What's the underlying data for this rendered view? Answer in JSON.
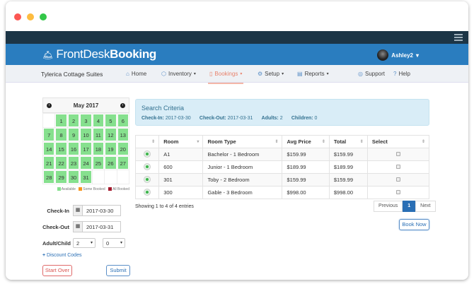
{
  "window": {
    "controls": [
      "close",
      "minimize",
      "maximize"
    ]
  },
  "brand": {
    "logo_light": "FrontDesk",
    "logo_bold": "Booking",
    "user": "Ashley2"
  },
  "nav": {
    "property": "Tylerica Cottage Suites",
    "items": [
      {
        "label": "Home",
        "icon": "home-icon",
        "caret": ""
      },
      {
        "label": "Inventory",
        "icon": "cube-icon",
        "caret": "▾"
      },
      {
        "label": "Bookings",
        "icon": "bookings-icon",
        "caret": "▾"
      },
      {
        "label": "Setup",
        "icon": "gears-icon",
        "caret": "▾"
      },
      {
        "label": "Reports",
        "icon": "reports-icon",
        "caret": "▾"
      },
      {
        "label": "Support",
        "icon": "lifebuoy-icon",
        "caret": ""
      },
      {
        "label": "Help",
        "icon": "help-icon",
        "caret": ""
      }
    ]
  },
  "calendar": {
    "title": "May 2017",
    "prev": "‹",
    "next": "›",
    "days": [
      "",
      "1",
      "2",
      "3",
      "4",
      "5",
      "6",
      "7",
      "8",
      "9",
      "10",
      "11",
      "12",
      "13",
      "14",
      "15",
      "16",
      "17",
      "18",
      "19",
      "20",
      "21",
      "22",
      "23",
      "24",
      "25",
      "26",
      "27",
      "28",
      "29",
      "30",
      "31",
      "",
      "",
      ""
    ],
    "legend": {
      "available": "Available",
      "some": "Some Booked",
      "all": "All Booked"
    },
    "colors": {
      "available": "#86e08e",
      "some": "#f7941d",
      "all": "#a3182b"
    }
  },
  "form": {
    "checkin_label": "Check-In",
    "checkin": "2017-03-30",
    "checkout_label": "Check-Out",
    "checkout": "2017-03-31",
    "adultchild_label": "Adult/Child",
    "adults": "2",
    "children": "0",
    "discount": "Discount Codes",
    "start_over": "Start Over",
    "submit": "Submit"
  },
  "criteria": {
    "title": "Search Criteria",
    "checkin_label": "Check-In:",
    "checkin": "2017-03-30",
    "checkout_label": "Check-Out:",
    "checkout": "2017-03-31",
    "adults_label": "Adults:",
    "adults": "2",
    "children_label": "Children:",
    "children": "0"
  },
  "table": {
    "headers": [
      "",
      "Room",
      "Room Type",
      "Avg Price",
      "Total",
      "Select"
    ],
    "rows": [
      {
        "room": "A1",
        "type": "Bachelor - 1 Bedroom",
        "avg": "$159.99",
        "total": "$159.99"
      },
      {
        "room": "600",
        "type": "Junior - 1 Bedroom",
        "avg": "$189.99",
        "total": "$189.99"
      },
      {
        "room": "301",
        "type": "Toby - 2 Bedroom",
        "avg": "$159.99",
        "total": "$159.99"
      },
      {
        "room": "300",
        "type": "Gable - 3 Bedroom",
        "avg": "$998.00",
        "total": "$998.00"
      }
    ]
  },
  "info": "Showing 1 to 4 of 4 entries",
  "pager": {
    "prev": "Previous",
    "page": "1",
    "next": "Next"
  },
  "book_now": "Book Now"
}
